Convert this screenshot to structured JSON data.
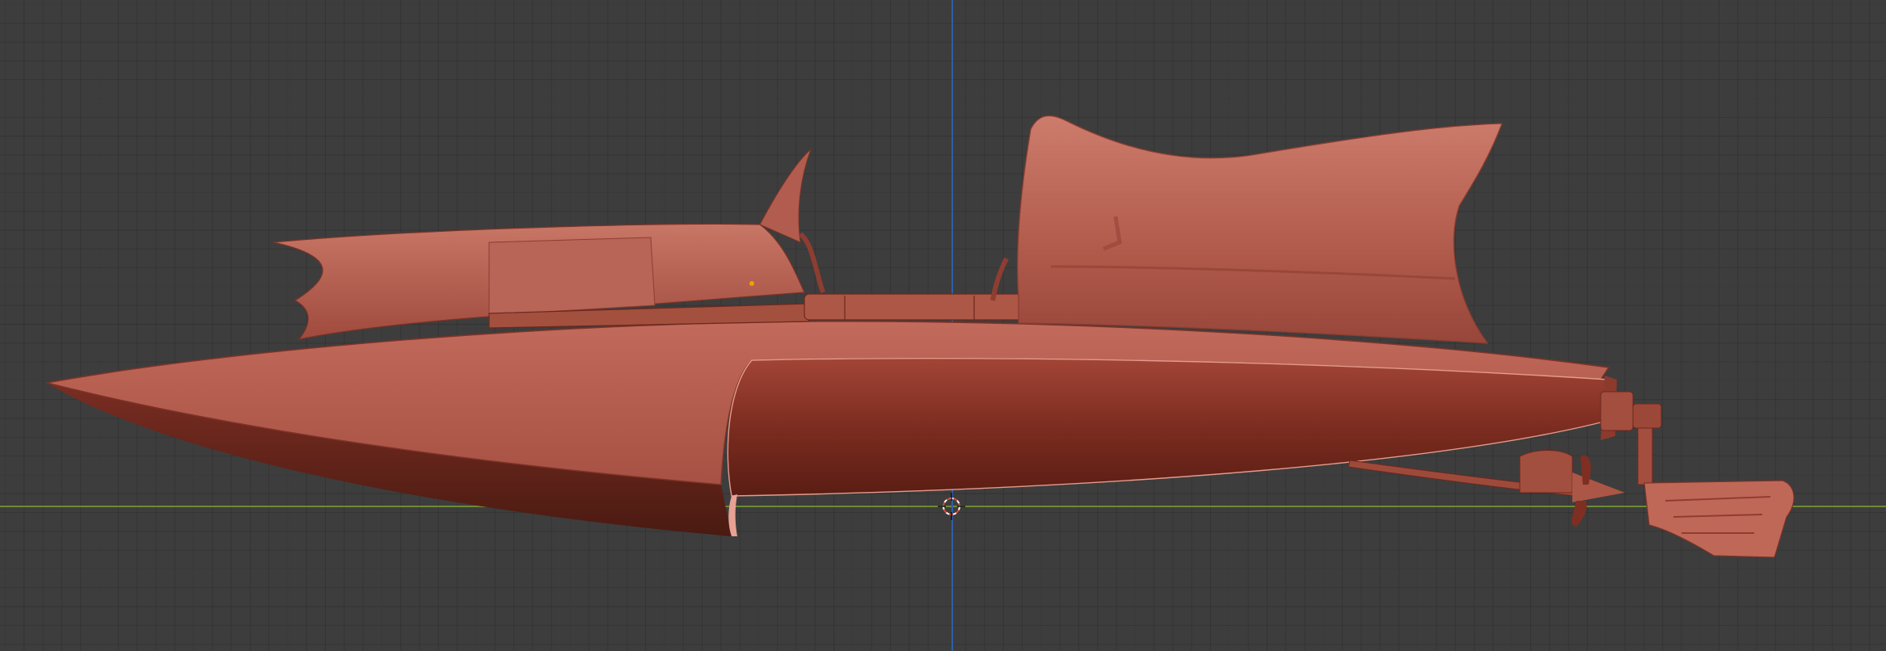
{
  "viewport": {
    "background_color": "#3d3d3d",
    "x_axis_color": "#6d8a34",
    "z_axis_color": "#2f5ea8"
  },
  "model": {
    "material_color": "#b0574a",
    "shadow_color": "#5e1f14"
  },
  "icons": {
    "cursor": "3d-cursor-icon",
    "origin": "object-origin-icon"
  }
}
